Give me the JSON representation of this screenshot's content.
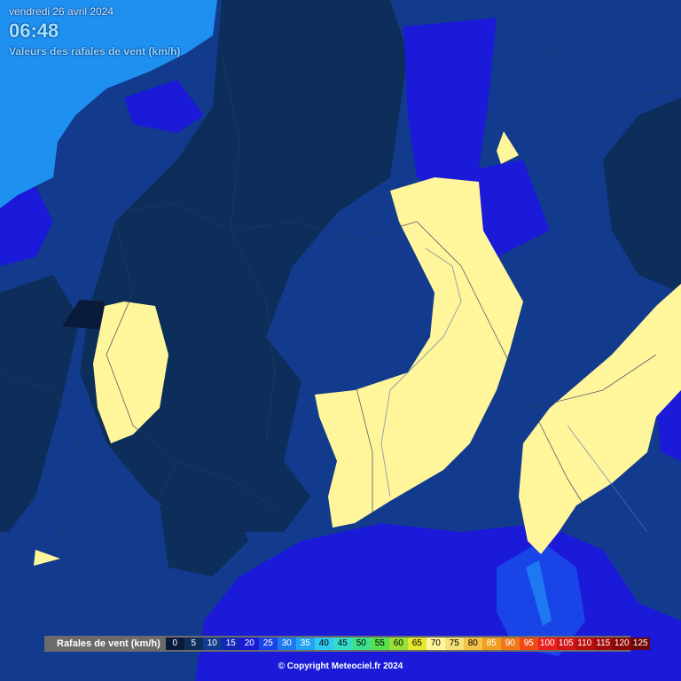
{
  "header": {
    "date": "vendredi 26 avril 2024",
    "time": "06:48",
    "subtitle": "Valeurs des rafales de vent (km/h)"
  },
  "legend": {
    "label": "Rafales de vent (km/h)",
    "steps": [
      {
        "value": "0",
        "color": "#0a1a3a",
        "text": "#ffffff"
      },
      {
        "value": "5",
        "color": "#0d2d5a",
        "text": "#ffffff"
      },
      {
        "value": "10",
        "color": "#123b8e",
        "text": "#ffffff"
      },
      {
        "value": "15",
        "color": "#1326b8",
        "text": "#ffffff"
      },
      {
        "value": "20",
        "color": "#1a1ad8",
        "text": "#ffffff"
      },
      {
        "value": "25",
        "color": "#1844e8",
        "text": "#ffffff"
      },
      {
        "value": "30",
        "color": "#1e78f0",
        "text": "#ffffff"
      },
      {
        "value": "35",
        "color": "#22a4f2",
        "text": "#ffffff"
      },
      {
        "value": "40",
        "color": "#2ec8f0",
        "text": "#000000"
      },
      {
        "value": "45",
        "color": "#36dcc8",
        "text": "#000000"
      },
      {
        "value": "50",
        "color": "#3ee090",
        "text": "#000000"
      },
      {
        "value": "55",
        "color": "#56e050",
        "text": "#000000"
      },
      {
        "value": "60",
        "color": "#9ae03a",
        "text": "#000000"
      },
      {
        "value": "65",
        "color": "#e6e830",
        "text": "#000000"
      },
      {
        "value": "70",
        "color": "#fff59a",
        "text": "#000000"
      },
      {
        "value": "75",
        "color": "#f6e07a",
        "text": "#000000"
      },
      {
        "value": "80",
        "color": "#f2c24a",
        "text": "#000000"
      },
      {
        "value": "85",
        "color": "#f0a020",
        "text": "#ffffff"
      },
      {
        "value": "90",
        "color": "#f07818",
        "text": "#ffffff"
      },
      {
        "value": "95",
        "color": "#ee4a18",
        "text": "#ffffff"
      },
      {
        "value": "100",
        "color": "#e82020",
        "text": "#ffffff"
      },
      {
        "value": "105",
        "color": "#d01818",
        "text": "#ffffff"
      },
      {
        "value": "110",
        "color": "#b81010",
        "text": "#ffffff"
      },
      {
        "value": "115",
        "color": "#a00c0c",
        "text": "#ffffff"
      },
      {
        "value": "120",
        "color": "#880808",
        "text": "#ffffff"
      },
      {
        "value": "125",
        "color": "#6e0606",
        "text": "#ffffff"
      }
    ]
  },
  "copyright": "© Copyright Meteociel.fr 2024",
  "colors": {
    "sea": "#1e90f0",
    "land_base": "#0b2a6e",
    "zone_05": "#0d2d5a",
    "zone_10": "#123b8e",
    "zone_15": "#1326b8",
    "zone_20": "#1a1ad8",
    "zone_70": "#fff59a",
    "borders": "#2a3a60"
  }
}
